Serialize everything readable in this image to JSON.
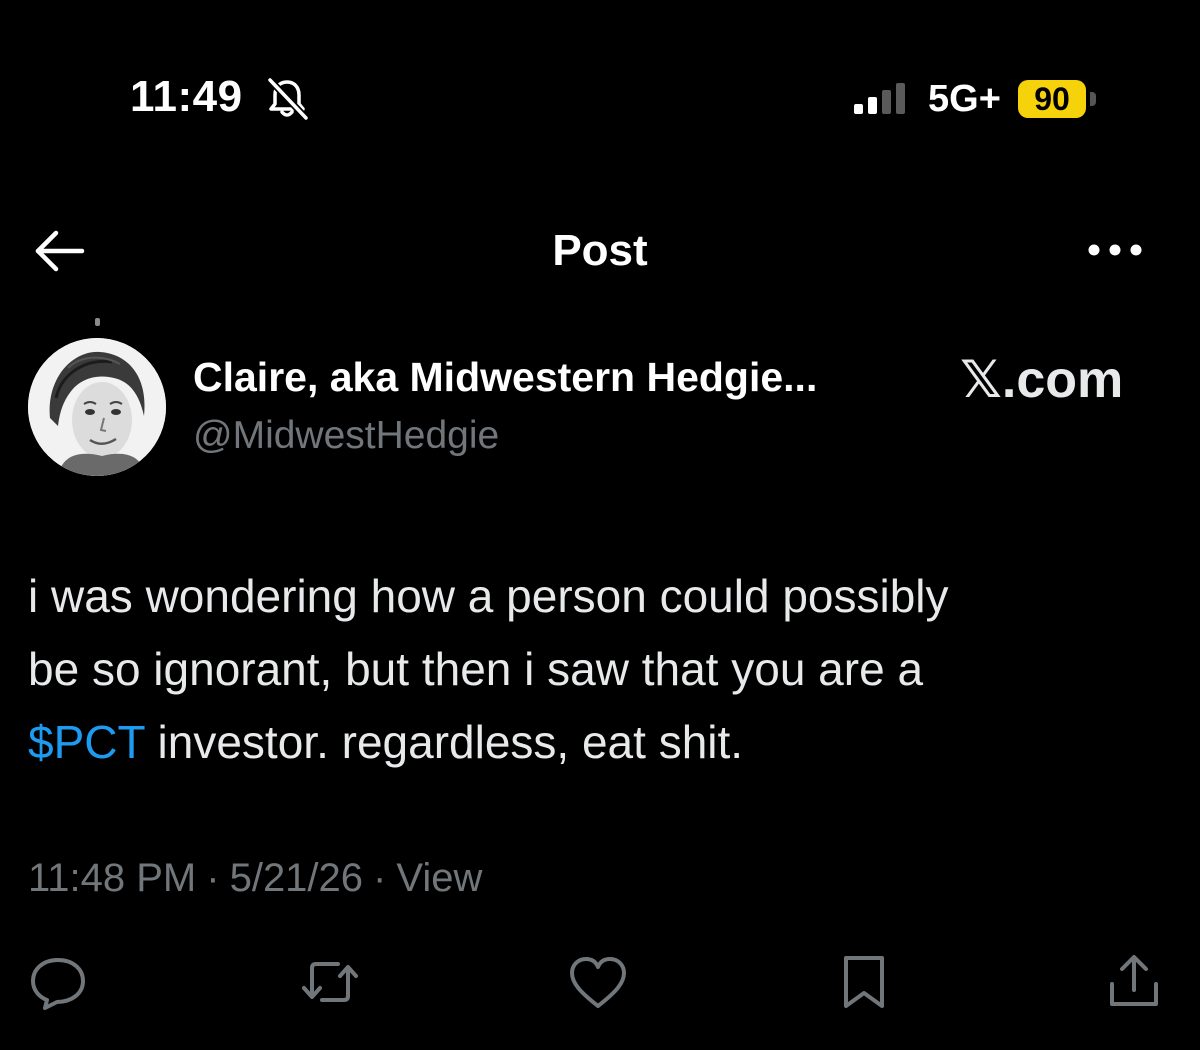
{
  "status_bar": {
    "time": "11:49",
    "network": "5G+",
    "battery": "90",
    "bell_icon": "bell-slash-icon",
    "signal_icon": "cellular-signal-icon",
    "battery_color": "#f5d20a"
  },
  "header": {
    "title": "Post",
    "back_icon": "arrow-left-icon",
    "more_icon": "more-horizontal-icon"
  },
  "author": {
    "display_name": "Claire, aka Midwestern Hedgie...",
    "handle": "@MidwestHedgie",
    "avatar_icon": "avatar"
  },
  "watermark": {
    "text": "𝕏.com"
  },
  "post": {
    "line1": "i was wondering how a person could possibly",
    "line2": "be so ignorant, but then i saw that you are a",
    "cashtag": "$PCT",
    "line3_rest": " investor. regardless, eat shit.",
    "link_color": "#1d9bf0"
  },
  "meta": {
    "time": "11:48 PM",
    "sep": "·",
    "date": "5/21/26",
    "views": "View"
  },
  "actions": [
    {
      "name": "reply",
      "icon": "reply-icon"
    },
    {
      "name": "repost",
      "icon": "repost-icon"
    },
    {
      "name": "like",
      "icon": "heart-icon"
    },
    {
      "name": "bookmark",
      "icon": "bookmark-icon"
    },
    {
      "name": "share",
      "icon": "share-icon"
    }
  ]
}
